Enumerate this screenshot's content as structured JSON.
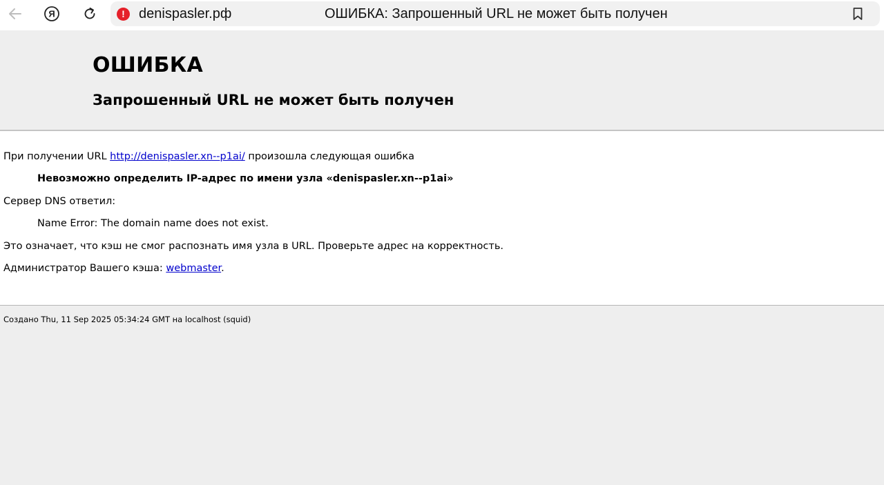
{
  "browser": {
    "domain": "denispasler.рф",
    "tab_title": "ОШИБКА: Запрошенный URL не может быть получен",
    "yandex_glyph": "Я",
    "warning_glyph": "!"
  },
  "page": {
    "title": "ОШИБКА",
    "subtitle": "Запрошенный URL не может быть получен",
    "intro_prefix": "При получении URL ",
    "intro_url": "http://denispasler.xn--p1ai/",
    "intro_suffix": " произошла следующая ошибка",
    "error_message": "Невозможно определить IP-адрес по имени узла «denispasler.xn--p1ai»",
    "dns_label": "Сервер DNS ответил:",
    "dns_response": "Name Error: The domain name does not exist.",
    "explanation": "Это означает, что кэш не смог распознать имя узла в URL. Проверьте адрес на корректность.",
    "admin_prefix": "Администратор Вашего кэша: ",
    "admin_link": "webmaster",
    "admin_suffix": ".",
    "footer": "Создано Thu, 11 Sep 2025 05:34:24 GMT на localhost (squid)"
  },
  "colors": {
    "link": "#0000cc",
    "warning": "#e5202a",
    "page_background": "#eeeeee"
  },
  "icons": {
    "back": "arrow-left-icon",
    "yandex": "yandex-logo-icon",
    "reload": "reload-icon",
    "warning": "warning-icon",
    "bookmark": "bookmark-icon"
  }
}
